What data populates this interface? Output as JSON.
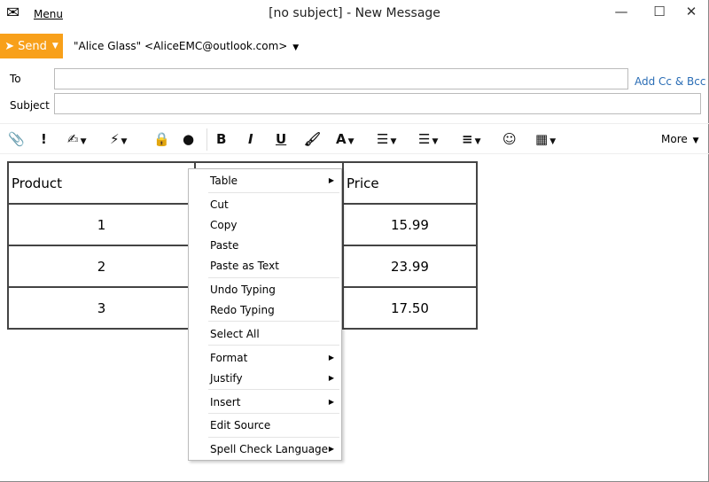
{
  "window": {
    "title": "[no subject] - New Message",
    "menu_label": "Menu",
    "minimize": "—",
    "maximize": "☐",
    "close": "✕"
  },
  "compose": {
    "send_label": "Send",
    "from": "\"Alice Glass\" <AliceEMC@outlook.com>",
    "to_label": "To",
    "to_value": "",
    "subject_label": "Subject",
    "subject_value": "",
    "add_cc_bcc": "Add Cc & Bcc"
  },
  "toolbar": {
    "more_label": "More"
  },
  "table": {
    "header": [
      "Product",
      "",
      "Price"
    ],
    "rows": [
      [
        "1",
        "",
        "15.99"
      ],
      [
        "2",
        "",
        "23.99"
      ],
      [
        "3",
        "",
        "17.50"
      ]
    ]
  },
  "context_menu": {
    "items": [
      {
        "label": "Table",
        "submenu": true
      },
      {
        "label": "Cut"
      },
      {
        "label": "Copy"
      },
      {
        "label": "Paste"
      },
      {
        "label": "Paste as Text"
      },
      {
        "label": "Undo Typing"
      },
      {
        "label": "Redo Typing"
      },
      {
        "label": "Select All"
      },
      {
        "label": "Format",
        "submenu": true
      },
      {
        "label": "Justify",
        "submenu": true
      },
      {
        "label": "Insert",
        "submenu": true
      },
      {
        "label": "Edit Source"
      },
      {
        "label": "Spell Check Language",
        "submenu": true
      }
    ]
  },
  "colors": {
    "send": "#f8a01a",
    "link": "#2a6db5"
  }
}
